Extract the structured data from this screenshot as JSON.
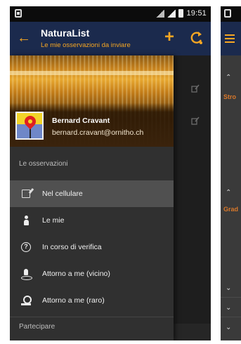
{
  "left_phone": {
    "status_bar": {
      "time": "19:51"
    },
    "toolbar": {
      "back_icon": "arrow-left-icon",
      "title": "NaturaList",
      "subtitle": "Le mie osservazioni da inviare",
      "add_icon": "plus-icon",
      "sync_icon": "sync-icon",
      "accent_color": "#f5a623",
      "background_color": "#1b2a4d"
    },
    "drawer": {
      "user": {
        "name": "Bernard Cravant",
        "email": "bernard.cravant@ornitho.ch"
      },
      "section_observations": "Le osservazioni",
      "items": [
        {
          "label": "Nel cellulare",
          "icon": "phone-edit-icon",
          "active": true
        },
        {
          "label": "Le mie",
          "icon": "person-icon",
          "active": false
        },
        {
          "label": "In corso di verifica",
          "icon": "question-icon",
          "active": false
        },
        {
          "label": "Attorno a me (vicino)",
          "icon": "nearby-person-icon",
          "active": false
        },
        {
          "label": "Attorno a me (raro)",
          "icon": "rare-pin-icon",
          "active": false
        }
      ],
      "section_participate": "Partecipare"
    }
  },
  "right_phone": {
    "labels": [
      "Stro",
      "Grad"
    ]
  }
}
